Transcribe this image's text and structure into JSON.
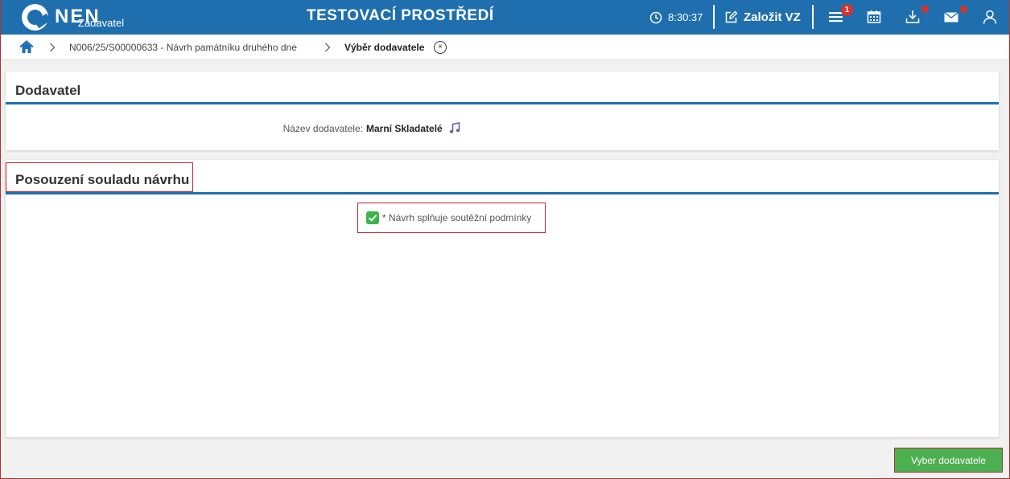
{
  "header": {
    "logo_text": "NEN",
    "logo_sub": "Zadavatel",
    "env_title": "TESTOVACÍ PROSTŘEDÍ",
    "clock": "8:30:37",
    "create_label": "Založit VZ",
    "menu_badge": "1",
    "icons": [
      "clock-icon",
      "edit-icon",
      "menu-icon",
      "calendar-icon",
      "download-icon",
      "mail-icon",
      "user-icon"
    ]
  },
  "breadcrumb": {
    "items": [
      "N006/25/S00000633 - Návrh památníku druhého dne",
      "Výběr dodavatele"
    ],
    "close_symbol": "×"
  },
  "supplier": {
    "title": "Dodavatel",
    "name_label": "Název dodavatele",
    "name_value": "Marní Skladatelé"
  },
  "assessment": {
    "title": "Posouzení souladu návrhu",
    "checkbox_label": "* Návrh splňuje soutěžní podmínky",
    "checked": true
  },
  "actions": {
    "select_label": "Vyber dodavatele"
  },
  "colors": {
    "header": "#1f6fae",
    "accent": "#1f6fae",
    "success": "#4caf50",
    "badge": "#d9312b",
    "highlight": "#c0272d"
  }
}
